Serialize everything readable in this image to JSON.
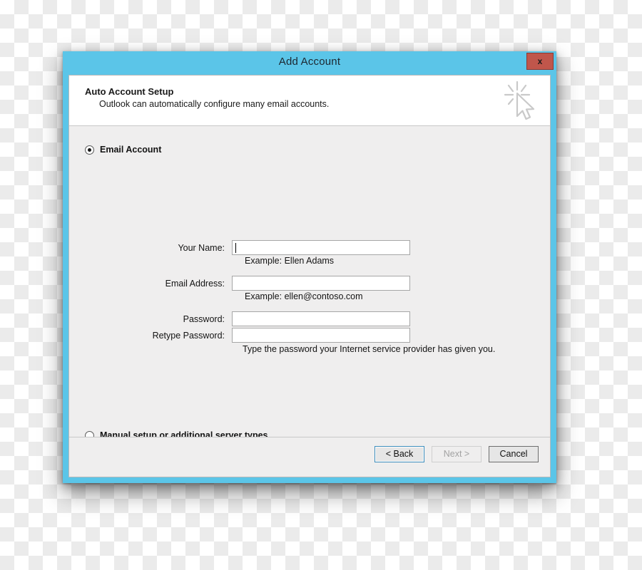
{
  "window": {
    "title": "Add Account",
    "close_label": "x",
    "frame_color": "#5bc5e8",
    "close_color": "#c0564b",
    "body_color": "#efeeee"
  },
  "header": {
    "title": "Auto Account Setup",
    "subtitle": "Outlook can automatically configure many email accounts.",
    "icon": "click-cursor-icon"
  },
  "options": {
    "email_account": {
      "label": "Email Account",
      "selected": true
    },
    "manual_setup": {
      "label": "Manual setup or additional server types",
      "selected": false
    }
  },
  "form": {
    "fields": [
      {
        "name": "your-name",
        "label": "Your Name:",
        "value": "",
        "placeholder": "",
        "focused": true,
        "hint": "Example: Ellen Adams"
      },
      {
        "name": "email-address",
        "label": "Email Address:",
        "value": "",
        "placeholder": "",
        "focused": false,
        "hint": "Example: ellen@contoso.com"
      },
      {
        "name": "password",
        "label": "Password:",
        "value": "",
        "placeholder": "",
        "focused": false,
        "hint": ""
      },
      {
        "name": "retype-password",
        "label": "Retype Password:",
        "value": "",
        "placeholder": "",
        "focused": false,
        "hint": ""
      }
    ],
    "password_hint": "Type the password your Internet service provider has given you."
  },
  "footer": {
    "buttons": [
      {
        "name": "back",
        "label": "< Back",
        "state": "focused"
      },
      {
        "name": "next",
        "label": "Next >",
        "state": "disabled"
      },
      {
        "name": "cancel",
        "label": "Cancel",
        "state": "normal"
      }
    ]
  }
}
